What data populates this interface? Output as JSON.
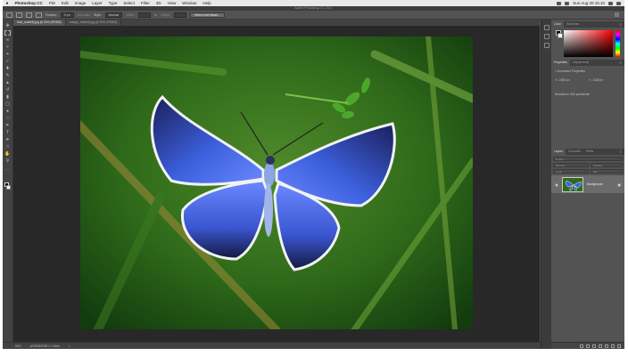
{
  "menubar": {
    "app_name": "Photoshop CC",
    "items": [
      "File",
      "Edit",
      "Image",
      "Layer",
      "Type",
      "Select",
      "Filter",
      "3D",
      "View",
      "Window",
      "Help"
    ],
    "clock": "Sun Aug 20  15:10"
  },
  "window": {
    "title": "Adobe Photoshop CC 2017"
  },
  "options": {
    "feather_label": "Feather:",
    "feather_value": "0 px",
    "antialias_label": "Anti-alias",
    "style_label": "Style:",
    "style_value": "Normal",
    "width_label": "Width:",
    "height_label": "Height:",
    "select_mask_button": "Select and Mask..."
  },
  "tabs": [
    {
      "label": "blue_butterfly.jpg @ 50% (RGB/8)"
    },
    {
      "label": "orange_butterfly.jpg @ 50% (RGB/8)"
    }
  ],
  "status": {
    "zoom": "50%",
    "doc_size": "pRGB/8/RGB 2.1 Mem"
  },
  "color_panel": {
    "tabs": [
      "Color",
      "Swatches"
    ]
  },
  "properties_panel": {
    "tabs": [
      "Properties",
      "Adjustments"
    ],
    "heading": "Document Properties",
    "width_label": "W:",
    "width_value": "2264 px",
    "height_label": "H:",
    "height_value": "1448 px",
    "resolution": "Resolution: 300 pixels/inch"
  },
  "layers_panel": {
    "tabs": [
      "Layers",
      "Channels",
      "Paths"
    ],
    "filter_label": "P Kind",
    "blend_mode": "Normal",
    "opacity_label": "Opacity:",
    "lock_label": "Lock:",
    "fill_label": "Fill:",
    "layer_name": "Background"
  }
}
